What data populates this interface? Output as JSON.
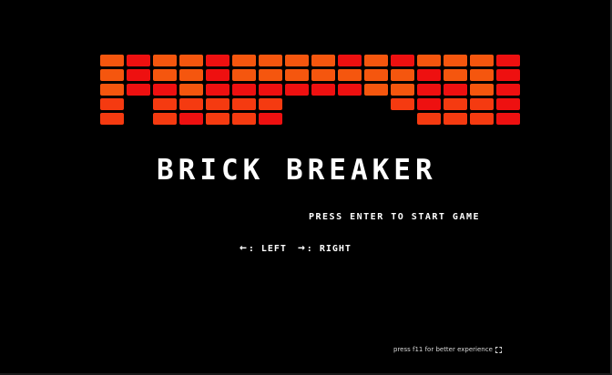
{
  "game": {
    "title": "BRICK BREAKER",
    "start_prompt": "PRESS ENTER TO START GAME",
    "controls": {
      "left_key_icon": "left-arrow-icon",
      "left_label": ": LEFT",
      "right_key_icon": "right-arrow-icon",
      "right_label": ": RIGHT"
    },
    "hint": "press f11 for better experience",
    "hint_icon": "fullscreen-icon"
  },
  "colors": {
    "background": "#000000",
    "text": "#ffffff",
    "brick_red": "#ee1010",
    "brick_orange_red": "#f53a10",
    "brick_orange": "#f5560e"
  },
  "brick_wall": {
    "columns": 16,
    "rows": 5,
    "pattern": [
      "OROOROOOOROROOOR",
      "OROOROOOOOOOROOR",
      "ORRORRRRRROORROR",
      "O.OOOOO....OROOR",
      "O.OROOR.....OOOR"
    ]
  }
}
